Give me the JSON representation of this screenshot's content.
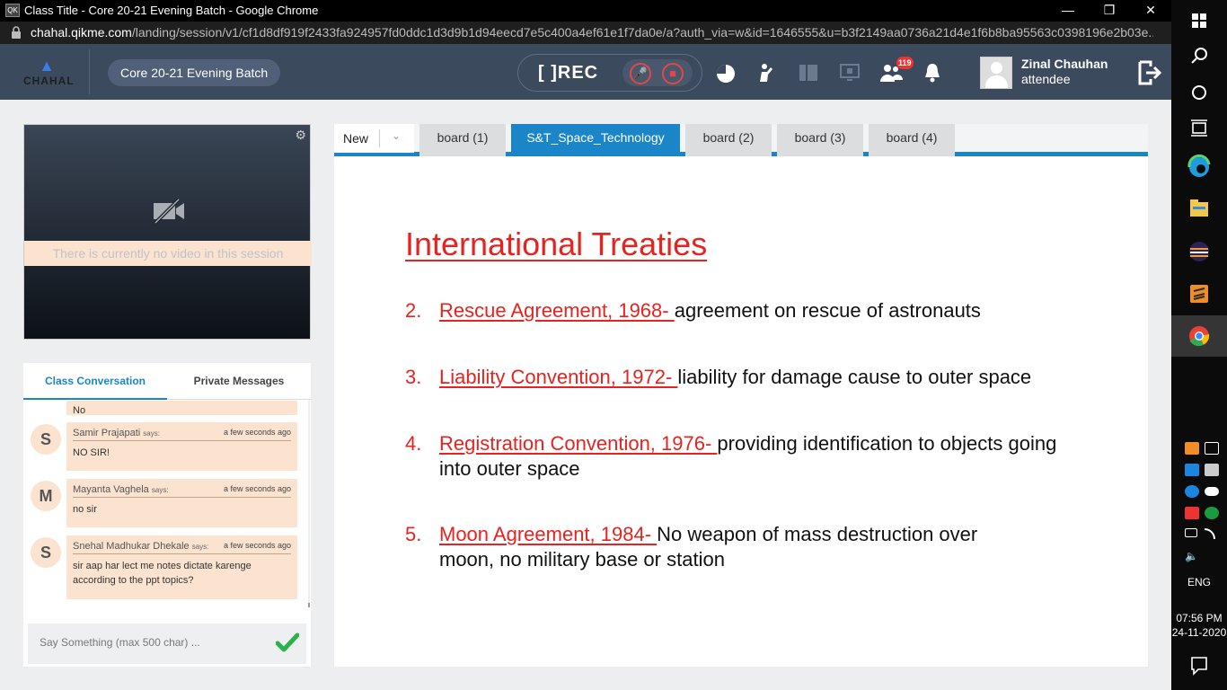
{
  "window": {
    "title": "Class Title - Core 20-21 Evening Batch - Google Chrome",
    "app_icon_label": "QK"
  },
  "address": {
    "domain": "chahal.qikme.com",
    "path": "/landing/session/v1/cf1d8df919f2433fa924957fd0ddc1d3d9b1d94eecd7e5c400a4ef61e1f7da0e/a?auth_via=w&id=1646555&u=b3f2149aa0736a21d4e1f6b8ba95563c0398196e2b03e..."
  },
  "header": {
    "logo_text": "CHAHAL",
    "batch": "Core 20-21 Evening Batch",
    "rec_label": "REC",
    "participants_badge": "119",
    "user_name": "Zinal Chauhan",
    "user_role": "attendee"
  },
  "video": {
    "message": "There is currently no video in this session"
  },
  "chat": {
    "tabs": [
      "Class Conversation",
      "Private Messages"
    ],
    "partial_text": "No",
    "says": "says:",
    "messages": [
      {
        "initial": "S",
        "name": "Samir Prajapati",
        "time": "a few seconds ago",
        "text": "NO SIR!"
      },
      {
        "initial": "M",
        "name": "Mayanta Vaghela",
        "time": "a few seconds ago",
        "text": "no sir"
      },
      {
        "initial": "S",
        "name": "Snehal Madhukar Dhekale",
        "time": "a few seconds ago",
        "text": "sir aap har lect me notes dictate karenge according to the ppt topics?"
      }
    ],
    "input_placeholder": "Say Something (max 500 char) ..."
  },
  "board": {
    "new_label": "New",
    "tabs": [
      "board (1)",
      "S&T_Space_Technology",
      "board (2)",
      "board (3)",
      "board (4)"
    ],
    "active_tab": 1,
    "slide": {
      "title": "International Treaties",
      "items": [
        {
          "num": "2.",
          "head": "Rescue Agreement, 1968- ",
          "text": "agreement on rescue of astronauts"
        },
        {
          "num": "3.",
          "head": "Liability Convention, 1972- ",
          "text": "liability for damage cause to outer space"
        },
        {
          "num": "4.",
          "head": "Registration Convention, 1976- ",
          "text": "providing identification to objects going into outer space"
        },
        {
          "num": "5.",
          "head": "Moon Agreement, 1984- ",
          "text": "No weapon of mass destruction over moon, no military base or station"
        }
      ]
    }
  },
  "taskbar": {
    "language": "ENG",
    "time": "07:56 PM",
    "date": "24-11-2020"
  },
  "colors": {
    "accent": "#1a86c8",
    "header": "#3c4a5e",
    "slide_red": "#e8221f",
    "chat_bubble": "#fbe3cf"
  }
}
